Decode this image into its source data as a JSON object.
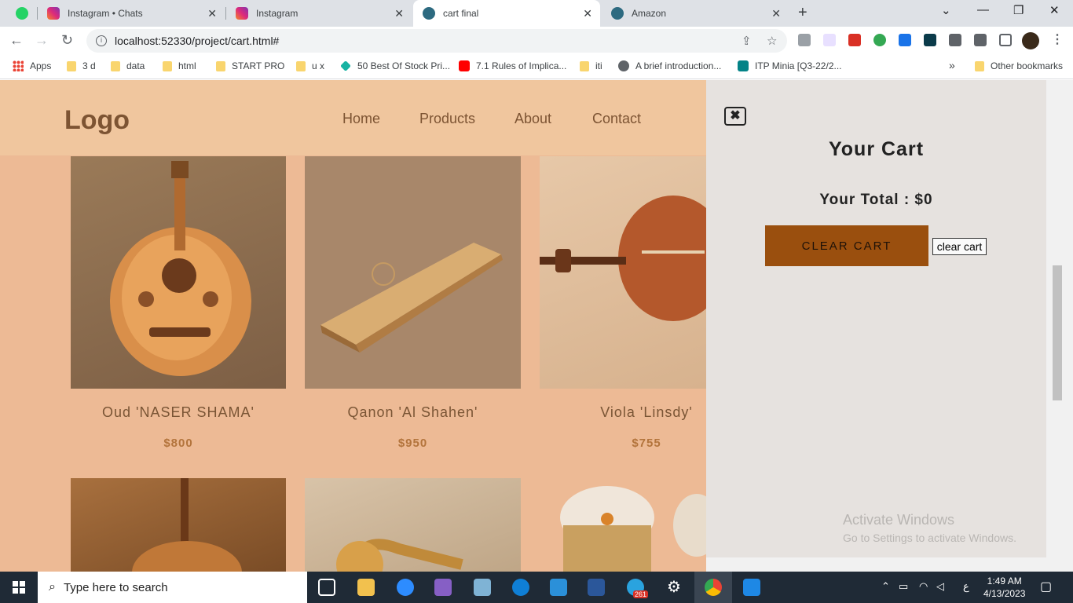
{
  "browser": {
    "tabs": [
      {
        "title": "Instagram • Chats",
        "active": false
      },
      {
        "title": "Instagram",
        "active": false
      },
      {
        "title": "cart final",
        "active": true
      },
      {
        "title": "Amazon",
        "active": false
      }
    ],
    "url": "localhost:52330/project/cart.html#",
    "bookmarks": [
      {
        "label": "Apps"
      },
      {
        "label": "3 d"
      },
      {
        "label": "data"
      },
      {
        "label": "html"
      },
      {
        "label": "START PRO"
      },
      {
        "label": "u x"
      },
      {
        "label": "50 Best Of Stock Pri..."
      },
      {
        "label": "7.1 Rules of Implica..."
      },
      {
        "label": "iti"
      },
      {
        "label": "A brief introduction..."
      },
      {
        "label": "ITP Minia [Q3-22/2..."
      },
      {
        "label": "»"
      },
      {
        "label": "Other bookmarks"
      }
    ]
  },
  "site": {
    "logo": "Logo",
    "nav": [
      {
        "label": "Home"
      },
      {
        "label": "Products"
      },
      {
        "label": "About"
      },
      {
        "label": "Contact"
      }
    ],
    "products": [
      {
        "name": "Oud 'NASER SHAMA'",
        "price": "$800"
      },
      {
        "name": "Qanon 'Al Shahen'",
        "price": "$950"
      },
      {
        "name": "Viola 'Linsdy'",
        "price": "$755"
      }
    ]
  },
  "cart": {
    "close": "✖",
    "title": "Your Cart",
    "total": "Your Total : $0",
    "clear_button": "CLEAR CART",
    "clear_button_plain": "clear cart"
  },
  "watermark": {
    "line1": "Activate Windows",
    "line2": "Go to Settings to activate Windows."
  },
  "taskbar": {
    "search_placeholder": "Type here to search",
    "telegram_badge": "261",
    "time": "1:49 AM",
    "date": "4/13/2023",
    "lang": "ع"
  }
}
